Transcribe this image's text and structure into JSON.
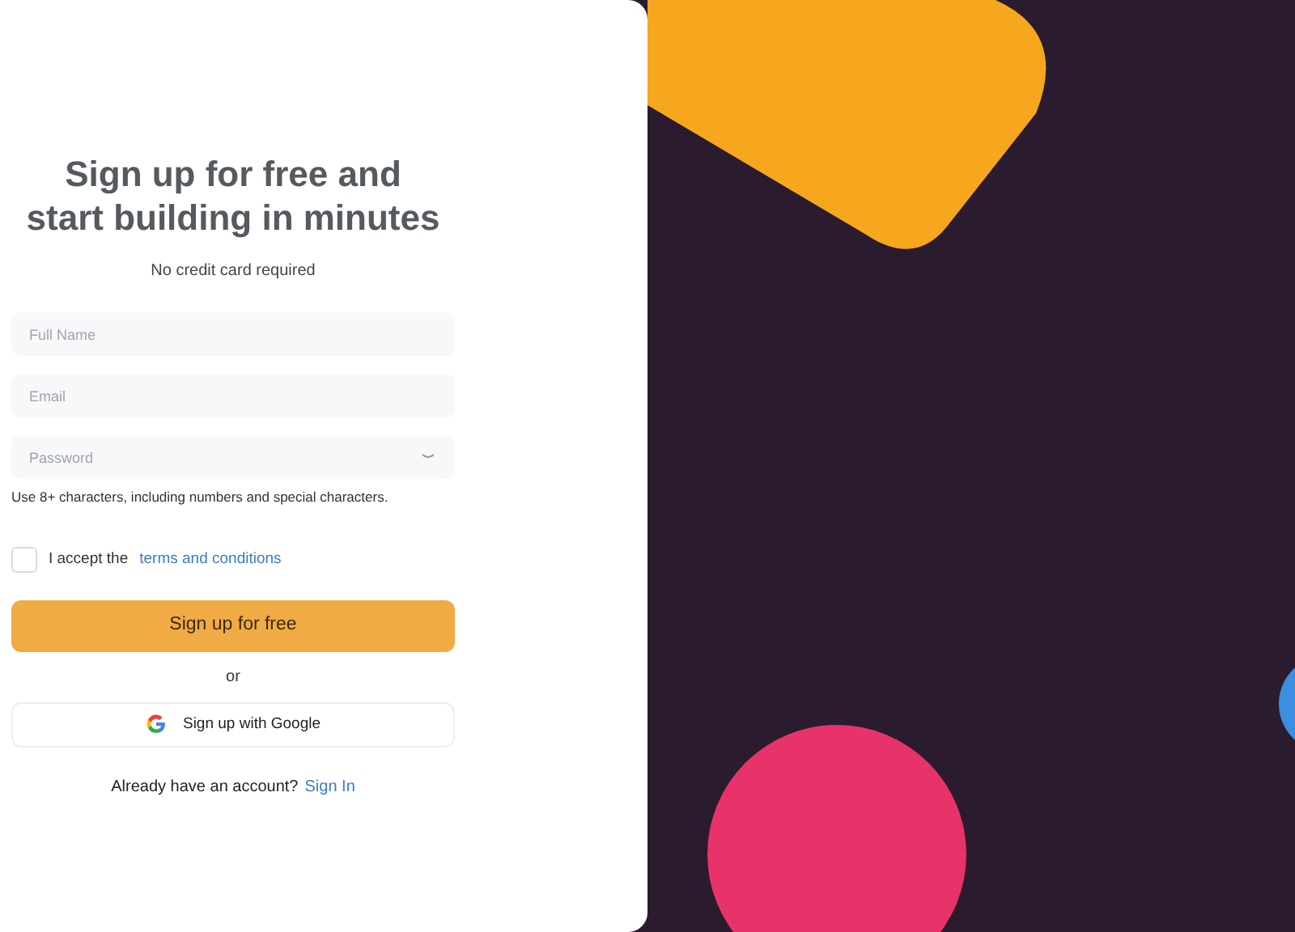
{
  "heading": "Sign up for free and start building in minutes",
  "subheading": "No credit card required",
  "fields": [
    {
      "kind": "text",
      "placeholder": "Full Name"
    },
    {
      "kind": "text",
      "placeholder": "Email"
    },
    {
      "kind": "password",
      "placeholder": "Password"
    }
  ],
  "password_hint": "Use 8+ characters, including numbers and special characters.",
  "terms": {
    "checked": false,
    "label": "I accept the",
    "link": "terms and conditions"
  },
  "submit_button": "Sign up for free",
  "divider": "or",
  "google_button": "Sign up with Google",
  "signin": {
    "prompt": "Already have an account?",
    "link": "Sign In"
  }
}
